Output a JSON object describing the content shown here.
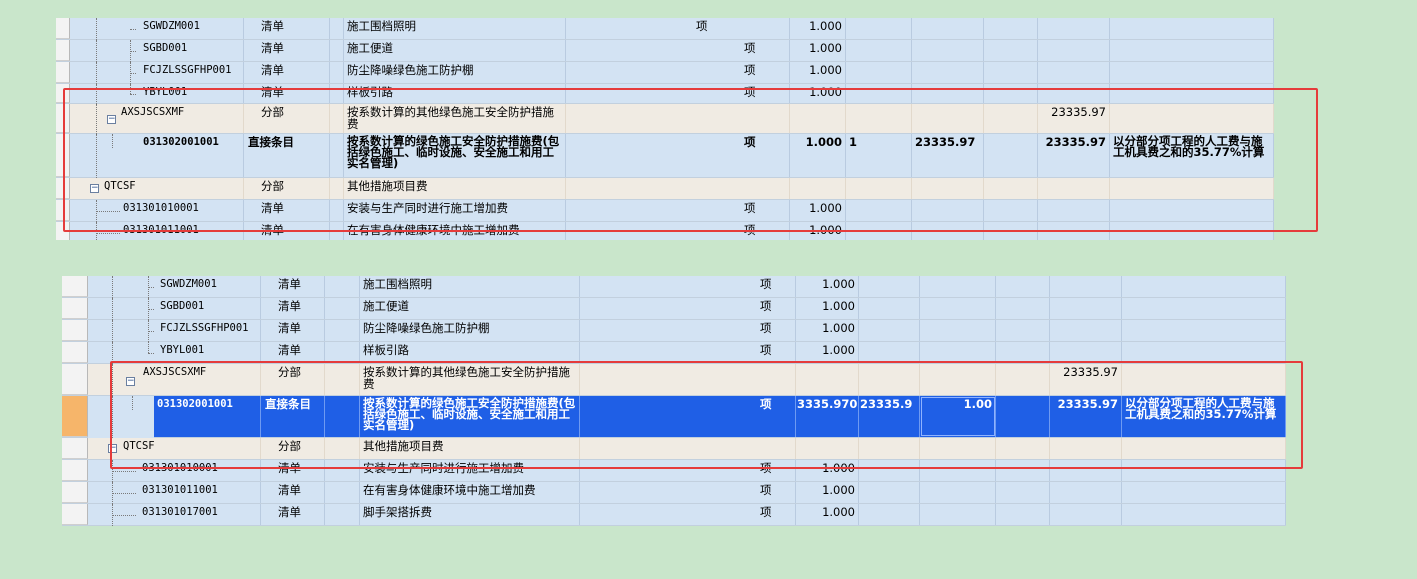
{
  "top_panel": {
    "rows": [
      {
        "code": "SGWDZM001",
        "type": "清单",
        "name": "施工围档照明",
        "unit": "项",
        "qty": "1.000"
      },
      {
        "code": "SGBD001",
        "type": "清单",
        "name": "施工便道",
        "unit": "项",
        "qty": "1.000"
      },
      {
        "code": "FCJZLSSGFHP001",
        "type": "清单",
        "name": "防尘降噪绿色施工防护棚",
        "unit": "项",
        "qty": "1.000"
      },
      {
        "code": "YBYL001",
        "type": "清单",
        "name": "样板引路",
        "unit": "项",
        "qty": "1.000"
      },
      {
        "code": "AXSJSCSXMF",
        "type": "分部",
        "name": "按系数计算的其他绿色施工安全防护措施费",
        "total": "23335.97"
      },
      {
        "code": "031302001001",
        "type": "直接条目",
        "name": "按系数计算的绿色施工安全防护措施费(包括绿色施工、临时设施、安全施工和用工实名管理)",
        "unit": "项",
        "qty": "1.000",
        "c1": "1",
        "c2": "23335.97",
        "total": "23335.97",
        "remark": "以分部分项工程的人工费与施工机具费之和的35.77%计算"
      },
      {
        "code": "QTCSF",
        "type": "分部",
        "name": "其他措施项目费"
      },
      {
        "code": "031301010001",
        "type": "清单",
        "name": "安装与生产同时进行施工增加费",
        "unit": "项",
        "qty": "1.000"
      },
      {
        "code": "031301011001",
        "type": "清单",
        "name": "在有害身体健康环境中施工增加费",
        "unit": "项",
        "qty": "1.000"
      }
    ]
  },
  "bottom_panel": {
    "rows": [
      {
        "code": "SGWDZM001",
        "type": "清单",
        "name": "施工围档照明",
        "unit": "项",
        "qty": "1.000"
      },
      {
        "code": "SGBD001",
        "type": "清单",
        "name": "施工便道",
        "unit": "项",
        "qty": "1.000"
      },
      {
        "code": "FCJZLSSGFHP001",
        "type": "清单",
        "name": "防尘降噪绿色施工防护棚",
        "unit": "项",
        "qty": "1.000"
      },
      {
        "code": "YBYL001",
        "type": "清单",
        "name": "样板引路",
        "unit": "项",
        "qty": "1.000"
      },
      {
        "code": "AXSJSCSXMF",
        "type": "分部",
        "name": "按系数计算的其他绿色施工安全防护措施费",
        "total": "23335.97"
      },
      {
        "code": "031302001001",
        "type": "直接条目",
        "name": "按系数计算的绿色施工安全防护措施费(包括绿色施工、临时设施、安全施工和用工实名管理)",
        "unit": "项",
        "qty": "3335.970",
        "c1": "23335.9",
        "c2": "1.00",
        "total": "23335.97",
        "remark": "以分部分项工程的人工费与施工机具费之和的35.77%计算"
      },
      {
        "code": "QTCSF",
        "type": "分部",
        "name": "其他措施项目费"
      },
      {
        "code": "031301010001",
        "type": "清单",
        "name": "安装与生产同时进行施工增加费",
        "unit": "项",
        "qty": "1.000"
      },
      {
        "code": "031301011001",
        "type": "清单",
        "name": "在有害身体健康环境中施工增加费",
        "unit": "项",
        "qty": "1.000"
      },
      {
        "code": "031301017001",
        "type": "清单",
        "name": "脚手架搭拆费",
        "unit": "项",
        "qty": "1.000"
      }
    ]
  },
  "colors": {
    "highlight": "#e53b3b",
    "selected": "#1f5fe6",
    "item_row": "#d3e3f3",
    "group_row": "#f0ebe3",
    "background": "#c9e6cb"
  }
}
